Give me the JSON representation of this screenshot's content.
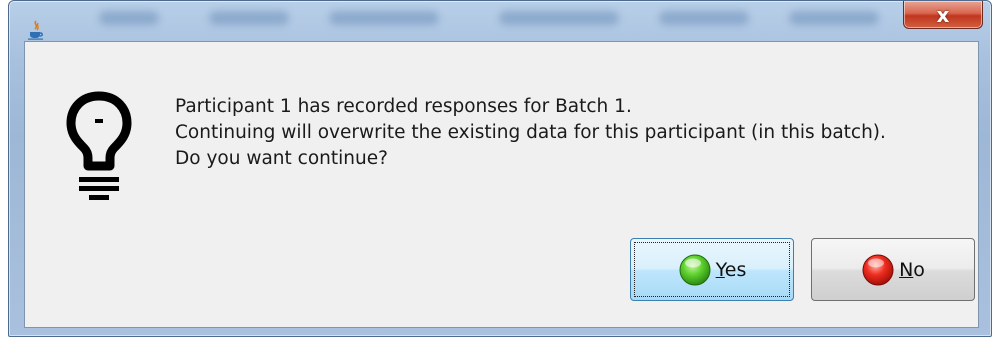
{
  "dialog": {
    "title": "",
    "close_label": "x",
    "icon": "lightbulb-icon",
    "message_lines": [
      "Participant 1 has recorded responses for Batch 1.",
      "Continuing will overwrite the existing data for this participant (in this batch).",
      "Do you want continue?"
    ],
    "buttons": {
      "yes": {
        "mnemonic": "Y",
        "rest": "es",
        "icon": "green-orb-icon",
        "default": true
      },
      "no": {
        "mnemonic": "N",
        "rest": "o",
        "icon": "red-orb-icon",
        "default": false
      }
    }
  },
  "colors": {
    "titlebar": "#a9c1de",
    "close": "#c0361f",
    "client": "#f0f0f0",
    "default_button": "#bee6fd",
    "yes_orb": "#3fbf1f",
    "no_orb": "#e0201a"
  }
}
